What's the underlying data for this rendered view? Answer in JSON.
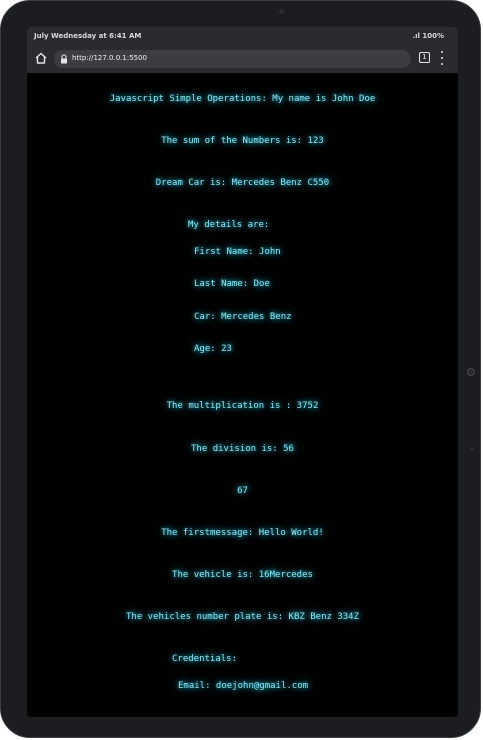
{
  "status": {
    "time": "July Wednesday at 6:41 AM",
    "signal_battery": "100%"
  },
  "browser": {
    "url": "http://127.0.0.1:5500",
    "tab_count": "1"
  },
  "page": {
    "heading": "Javascript Simple Operations: My name is John Doe",
    "sum": "The sum of the Numbers is: 123",
    "dream_car": "Dream Car is: Mercedes Benz C550",
    "details_label": "My details are:",
    "first_name": "First Name: John",
    "last_name": "Last Name: Doe",
    "car": "Car: Mercedes Benz",
    "age": "Age: 23",
    "multiplication": "The multiplication is : 3752",
    "division": "The division is: 56",
    "number": "67",
    "firstmessage": "The firstmessage: Hello World!",
    "vehicle": "The vehicle is: 16Mercedes",
    "plate": "The vehicles number plate is: KBZ Benz 334Z",
    "credentials_label": "Credentials:",
    "email": "Email: doejohn@gmail.com"
  }
}
